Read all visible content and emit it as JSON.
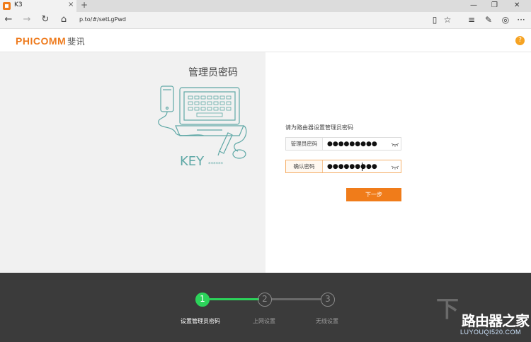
{
  "browser": {
    "tab_title": "K3",
    "tab_close": "×",
    "new_tab": "+",
    "url": "p.to/#/setLgPwd",
    "win_min": "—",
    "win_max": "❐",
    "win_close": "✕"
  },
  "header": {
    "logo_en": "PHICOMM",
    "logo_cn": "斐讯",
    "help": "?"
  },
  "illustration": {
    "title": "管理员密码",
    "key_text": "KEY",
    "stars": "******"
  },
  "form": {
    "hint": "请为路由器设置管理员密码",
    "password_label": "管理员密码",
    "password_value": "●●●●●●●●●",
    "confirm_label": "确认密码",
    "confirm_value": "●●●●●●●●●",
    "next_label": "下一步"
  },
  "steps": [
    {
      "num": "1",
      "label": "设置管理员密码",
      "active": true
    },
    {
      "num": "2",
      "label": "上网设置",
      "active": false
    },
    {
      "num": "3",
      "label": "无线设置",
      "active": false
    }
  ],
  "watermark": {
    "main": "路由器之家",
    "sub": "LUYOUQI520.COM",
    "glyph": "下"
  },
  "colors": {
    "brand_orange": "#f07c1a",
    "step_active": "#2cd35a",
    "footer_bg": "#3b3b3b"
  }
}
